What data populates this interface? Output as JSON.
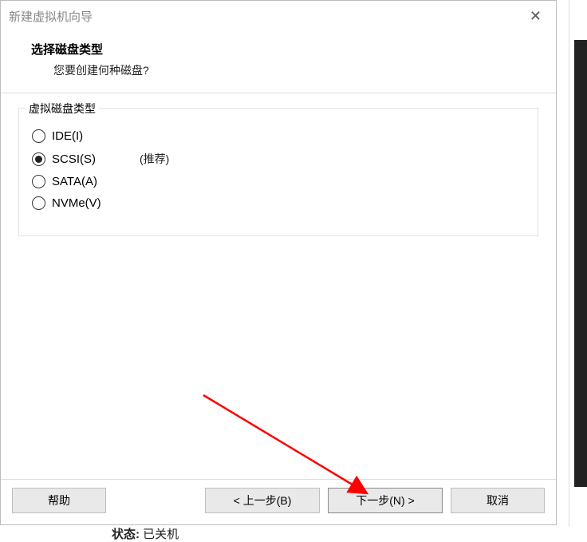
{
  "window": {
    "title": "新建虚拟机向导"
  },
  "header": {
    "title": "选择磁盘类型",
    "subtitle": "您要创建何种磁盘?"
  },
  "group": {
    "legend": "虚拟磁盘类型",
    "options": [
      {
        "label": "IDE(I)",
        "hint": "",
        "selected": false
      },
      {
        "label": "SCSI(S)",
        "hint": "(推荐)",
        "selected": true
      },
      {
        "label": "SATA(A)",
        "hint": "",
        "selected": false
      },
      {
        "label": "NVMe(V)",
        "hint": "",
        "selected": false
      }
    ]
  },
  "buttons": {
    "help": "帮助",
    "back": "< 上一步(B)",
    "next": "下一步(N) >",
    "cancel": "取消"
  },
  "footer": {
    "status_label": "状态:",
    "status_value": "已关机"
  }
}
